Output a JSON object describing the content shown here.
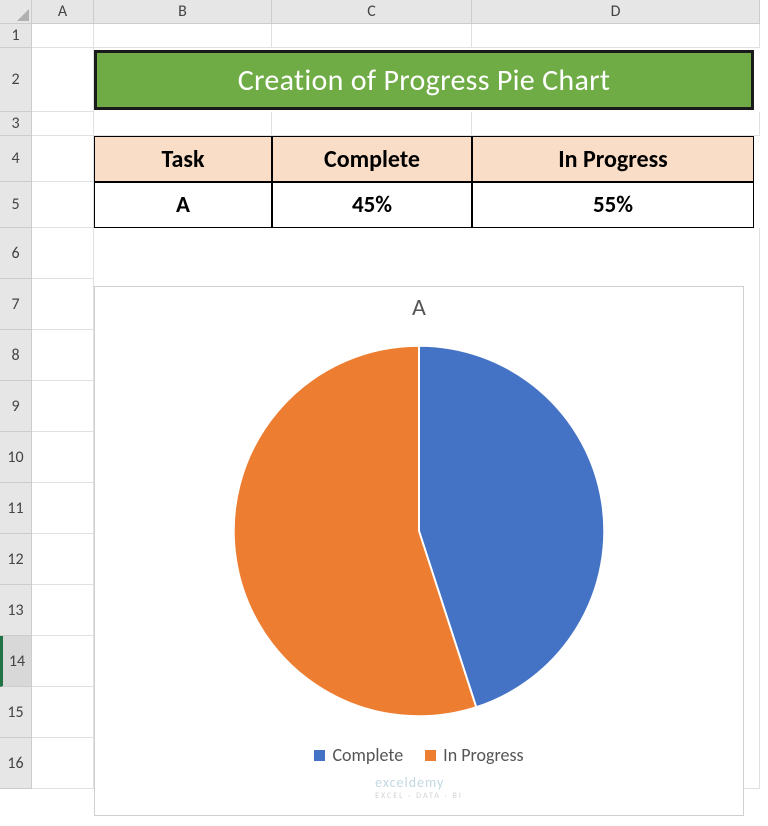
{
  "columns": [
    "A",
    "B",
    "C",
    "D"
  ],
  "rows": [
    "1",
    "2",
    "3",
    "4",
    "5",
    "6",
    "7",
    "8",
    "9",
    "10",
    "11",
    "12",
    "13",
    "14",
    "15",
    "16"
  ],
  "selected_row": "14",
  "banner": {
    "title": "Creation of Progress Pie Chart"
  },
  "table": {
    "headers": [
      "Task",
      "Complete",
      "In Progress"
    ],
    "row": [
      "A",
      "45%",
      "55%"
    ]
  },
  "chart_data": {
    "type": "pie",
    "title": "A",
    "series": [
      {
        "name": "Complete",
        "value": 45,
        "color": "#4472c4"
      },
      {
        "name": "In Progress",
        "value": 55,
        "color": "#ed7d31"
      }
    ]
  },
  "watermark": {
    "brand": "exceldemy",
    "tag": "EXCEL · DATA · BI"
  }
}
